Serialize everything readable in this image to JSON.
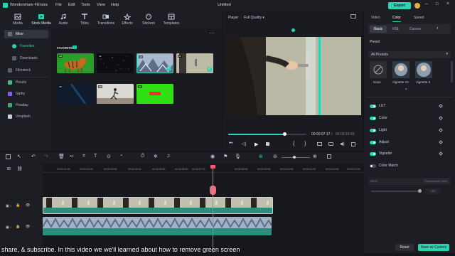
{
  "app": {
    "name": "Wondershare Filmora",
    "menu": [
      "File",
      "Edit",
      "Tools",
      "View",
      "Help"
    ],
    "project_title": "Untitled",
    "export_label": "Export"
  },
  "toolbar": {
    "tools": [
      {
        "label": "Media",
        "icon": "media-icon"
      },
      {
        "label": "Stock Media",
        "icon": "stock-media-icon"
      },
      {
        "label": "Audio",
        "icon": "audio-icon"
      },
      {
        "label": "Titles",
        "icon": "titles-icon"
      },
      {
        "label": "Transitions",
        "icon": "transitions-icon"
      },
      {
        "label": "Effects",
        "icon": "effects-icon"
      },
      {
        "label": "Stickers",
        "icon": "stickers-icon"
      },
      {
        "label": "Templates",
        "icon": "templates-icon"
      }
    ],
    "active": "Stock Media"
  },
  "sidebar": {
    "items": [
      {
        "label": "Mine",
        "selected": true
      },
      {
        "label": "Favorites"
      },
      {
        "label": "Downloads"
      },
      {
        "label": "Filmstock"
      },
      {
        "label": "Pexels"
      },
      {
        "label": "Giphy"
      },
      {
        "label": "Pixabay"
      },
      {
        "label": "Unsplash"
      }
    ]
  },
  "media": {
    "section_label": "FAVORITES",
    "count": "7",
    "thumb_tags": [
      "HD",
      "4K",
      "HD",
      "4K",
      "HD",
      "HD",
      "4K"
    ]
  },
  "player": {
    "label": "Player",
    "quality": "Full Quality",
    "current_time": "00:00:07:17",
    "total_time": "00:00:10:09",
    "progress": 0.72
  },
  "right_panel": {
    "tabs": [
      "Video",
      "Color",
      "Speed"
    ],
    "active_tab": "Color",
    "subtabs": [
      "Basic",
      "HSL",
      "Curves"
    ],
    "active_subtab": "Basic",
    "preset_label": "Preset",
    "preset_filter": "All Presets",
    "presets": [
      "None",
      "Vignette 10",
      "Vignette 9"
    ],
    "props": [
      {
        "label": "LUT",
        "on": true
      },
      {
        "label": "Color",
        "on": true
      },
      {
        "label": "Light",
        "on": true
      },
      {
        "label": "Adjust",
        "on": true
      },
      {
        "label": "Vignette",
        "on": true
      },
      {
        "label": "Color Match",
        "on": false
      }
    ],
    "slider_label": "Value",
    "slider_value": "100",
    "compare_label": "Comparison View",
    "reset_label": "Reset",
    "save_custom_label": "Save as Custom"
  },
  "timeline": {
    "ruler": [
      "00:00:00",
      "00:00:01:00",
      "00:00:02:00",
      "00:00:03:00",
      "00:00:04:00",
      "00:00:05:00",
      "00:00:06:00",
      "00:00:07:00",
      "00:00:08:00",
      "00:00:09:00",
      "00:00:10:00",
      "00:00:11:00",
      "00:00:12:00",
      "00:00:13:00"
    ],
    "track_labels": [
      "2",
      "1"
    ]
  },
  "subtitle": "share, & subscribe. In this video we we'll learned about how to remove green screen",
  "colors": {
    "accent": "#2bd3b3",
    "playhead": "#ff5a6e",
    "bg": "#15161a"
  }
}
